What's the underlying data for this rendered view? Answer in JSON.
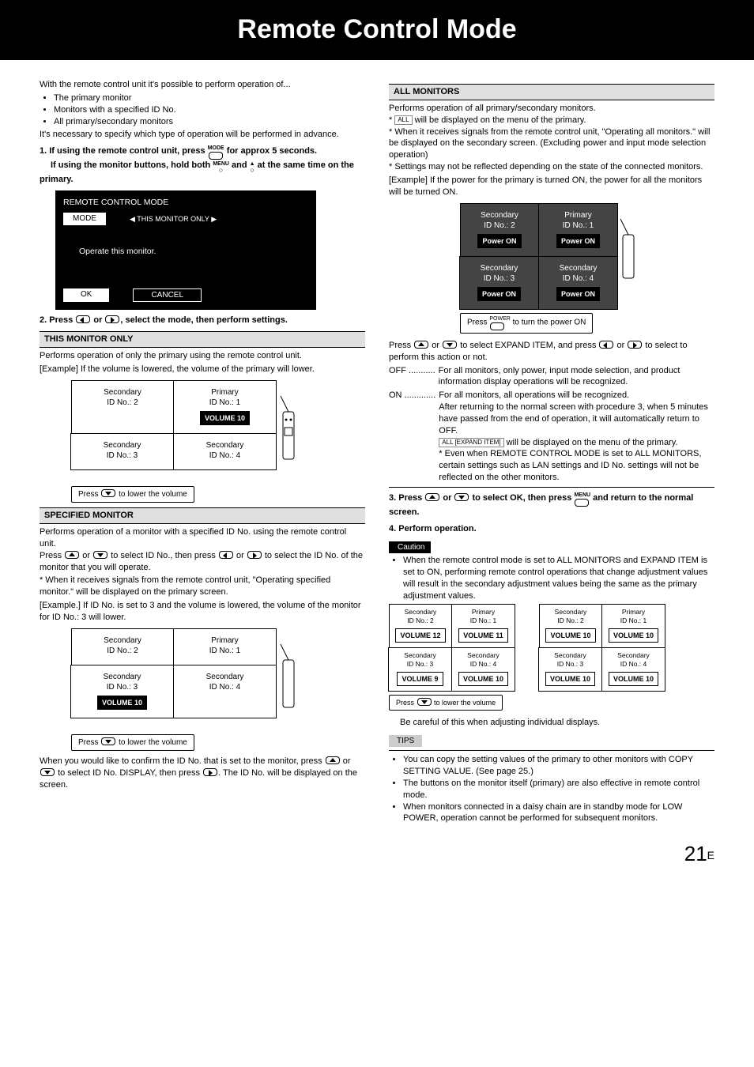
{
  "title": "Remote Control Mode",
  "intro": "With the remote control unit it's possible to perform operation of...",
  "intro_bullets": [
    "The primary monitor",
    "Monitors with a specified ID No.",
    "All primary/secondary monitors"
  ],
  "intro_tail": "It's necessary to specify which type of operation will be performed in advance.",
  "step1_a": "If using the remote control unit, press",
  "step1_a_icon": "MODE",
  "step1_a_tail": "for approx 5 seconds.",
  "step1_b": "If using the monitor buttons, hold both",
  "step1_b_icon1": "MENU",
  "step1_b_mid": "and",
  "step1_b_tail": "at the same time on the primary.",
  "osd": {
    "title": "REMOTE CONTROL MODE",
    "mode": "MODE",
    "option": "◀ THIS MONITOR ONLY ▶",
    "body": "Operate this monitor.",
    "ok": "OK",
    "cancel": "CANCEL"
  },
  "step2": "Press",
  "step2_mid": "or",
  "step2_tail": ", select the mode, then perform settings.",
  "this_monitor": {
    "head": "THIS MONITOR ONLY",
    "p1": "Performs operation of only the primary using the remote control unit.",
    "ex_head": "[Example] If the volume is lowered, the volume of the primary will lower.",
    "cells": [
      {
        "t1": "Secondary",
        "t2": "ID No.: 2",
        "vol": ""
      },
      {
        "t1": "Primary",
        "t2": "ID No.: 1",
        "vol": "VOLUME 10"
      },
      {
        "t1": "Secondary",
        "t2": "ID No.: 3",
        "vol": ""
      },
      {
        "t1": "Secondary",
        "t2": "ID No.: 4",
        "vol": ""
      }
    ],
    "press": "Press",
    "press_tail": "to lower the volume"
  },
  "specified": {
    "head": "SPECIFIED MONITOR",
    "p1": "Performs operation of a monitor with a specified ID No. using the remote control unit.",
    "p2a": "Press",
    "p2b": "or",
    "p2c": "to select ID No., then press",
    "p2d": "or",
    "p2e": "to select the ID No. of the monitor that you will operate.",
    "note": "* When it receives signals from  the remote control unit, \"Operating specified monitor.\" will be displayed on the primary screen.",
    "ex_head": "[Example.] If ID No. is set to 3 and the volume is lowered, the volume of the monitor for ID No.: 3 will lower.",
    "cells": [
      {
        "t1": "Secondary",
        "t2": "ID No.: 2",
        "vol": ""
      },
      {
        "t1": "Primary",
        "t2": "ID No.: 1",
        "vol": ""
      },
      {
        "t1": "Secondary",
        "t2": "ID No.: 3",
        "vol": "VOLUME 10"
      },
      {
        "t1": "Secondary",
        "t2": "ID No.: 4",
        "vol": ""
      }
    ],
    "press": "Press",
    "press_tail": "to lower the volume",
    "confirm": "When you would like to confirm the ID No. that is set to the monitor, press",
    "confirm_mid": "or",
    "confirm_mid2": "to select ID No. DISPLAY, then press",
    "confirm_tail": ". The ID No. will be displayed on the screen."
  },
  "all_monitors": {
    "head": "ALL MONITORS",
    "p1": "Performs operation of all primary/secondary monitors.",
    "n1a": "*",
    "n1_box": "ALL",
    "n1b": "will be displayed on the menu of the primary.",
    "n2": "* When it receives signals from the remote control unit, \"Operating all monitors.\" will be displayed on the secondary screen. (Excluding power and input mode selection operation)",
    "n3": "* Settings may not be reflected depending on the state of the connected monitors.",
    "ex_head": "[Example] If the power for the primary is turned ON, the power for all the monitors will be turned ON.",
    "cells": [
      {
        "t1": "Secondary",
        "t2": "ID No.: 2",
        "vol": "Power ON"
      },
      {
        "t1": "Primary",
        "t2": "ID No.: 1",
        "vol": "Power ON"
      },
      {
        "t1": "Secondary",
        "t2": "ID No.: 3",
        "vol": "Power ON"
      },
      {
        "t1": "Secondary",
        "t2": "ID No.: 4",
        "vol": "Power ON"
      }
    ],
    "press": "Press",
    "press_label": "POWER",
    "press_tail": "to turn the power ON",
    "expand_a": "Press",
    "expand_b": "or",
    "expand_c": "to select EXPAND ITEM, and press",
    "expand_d": "or",
    "expand_e": "to select to perform this action or not.",
    "off_label": "OFF ...........",
    "off_body": "For all monitors, only power, input mode selection, and product information display operations will be recognized.",
    "on_label": "ON .............",
    "on_body": "For all monitors, all operations will be recognized.",
    "on_body2": "After returning to the normal screen with procedure 3, when 5 minutes have passed from the end of operation, it will automatically return to OFF.",
    "on_box": "ALL [EXPAND ITEM]",
    "on_body3": "will be displayed on the menu of the primary.",
    "on_star": "* Even when REMOTE CONTROL MODE is set to ALL MONITORS, certain settings such as LAN settings and ID No. settings will not be reflected on the other monitors."
  },
  "step3_a": "Press",
  "step3_b": "or",
  "step3_c": "to select OK, then press",
  "step3_icon": "MENU",
  "step3_d": "and return to the normal screen.",
  "step4": "Perform operation.",
  "caution_label": "Caution",
  "caution_body": "When the remote control mode is set to ALL MONITORS and EXPAND ITEM is set to ON, performing remote control operations that change adjustment values will result in the secondary adjustment values being the same as the primary adjustment values.",
  "caution_grid_left": [
    {
      "t1": "Secondary",
      "t2": "ID No.: 2",
      "vol": "VOLUME 12"
    },
    {
      "t1": "Primary",
      "t2": "ID No.: 1",
      "vol": "VOLUME 11"
    },
    {
      "t1": "Secondary",
      "t2": "ID No.: 3",
      "vol": "VOLUME 9"
    },
    {
      "t1": "Secondary",
      "t2": "ID No.: 4",
      "vol": "VOLUME 10"
    }
  ],
  "caution_grid_right": [
    {
      "t1": "Secondary",
      "t2": "ID No.: 2",
      "vol": "VOLUME 10"
    },
    {
      "t1": "Primary",
      "t2": "ID No.: 1",
      "vol": "VOLUME 10"
    },
    {
      "t1": "Secondary",
      "t2": "ID No.: 3",
      "vol": "VOLUME 10"
    },
    {
      "t1": "Secondary",
      "t2": "ID No.: 4",
      "vol": "VOLUME 10"
    }
  ],
  "caution_press": "Press",
  "caution_press_tail": "to lower the volume",
  "caution_tail": "Be careful of this when adjusting individual displays.",
  "tips_label": "TIPS",
  "tips": [
    "You can copy the setting values of the primary to other monitors with COPY SETTING VALUE. (See page 25.)",
    "The buttons on the monitor itself (primary) are also effective in remote control mode.",
    "When monitors connected in a daisy chain are in standby mode for LOW POWER, operation cannot be performed for subsequent monitors."
  ],
  "page_no": "21",
  "page_suffix": "E"
}
